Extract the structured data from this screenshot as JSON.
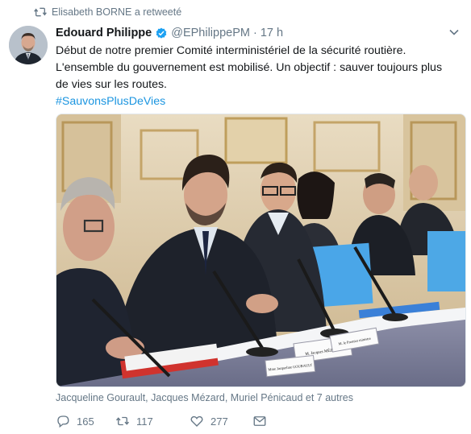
{
  "retweet_context": {
    "text": "Elisabeth BORNE a retweeté",
    "icon": "retweet-icon"
  },
  "tweet": {
    "author_name": "Edouard Philippe",
    "verified": true,
    "handle": "@EPhilippePM",
    "separator": "·",
    "time": "17 h",
    "text": "Début de notre premier Comité interministériel de la sécurité routière.  L'ensemble du gouvernement est mobilisé. Un objectif : sauver toujours plus de vies sur les routes.",
    "hashtag": "#SauvonsPlusDeVies",
    "tagged": "Jacqueline Gourault, Jacques Mézard, Muriel Pénicaud et 7 autres",
    "name_plates": [
      "M. Jacques MÉZARD",
      "M. le Premier ministre",
      "Mme Jacqueline GOURAULT"
    ]
  },
  "actions": {
    "replies": "165",
    "retweets": "117",
    "likes": "277"
  },
  "colors": {
    "link": "#1b95e0",
    "secondary_text": "#657786",
    "verified": "#1da1f2"
  }
}
